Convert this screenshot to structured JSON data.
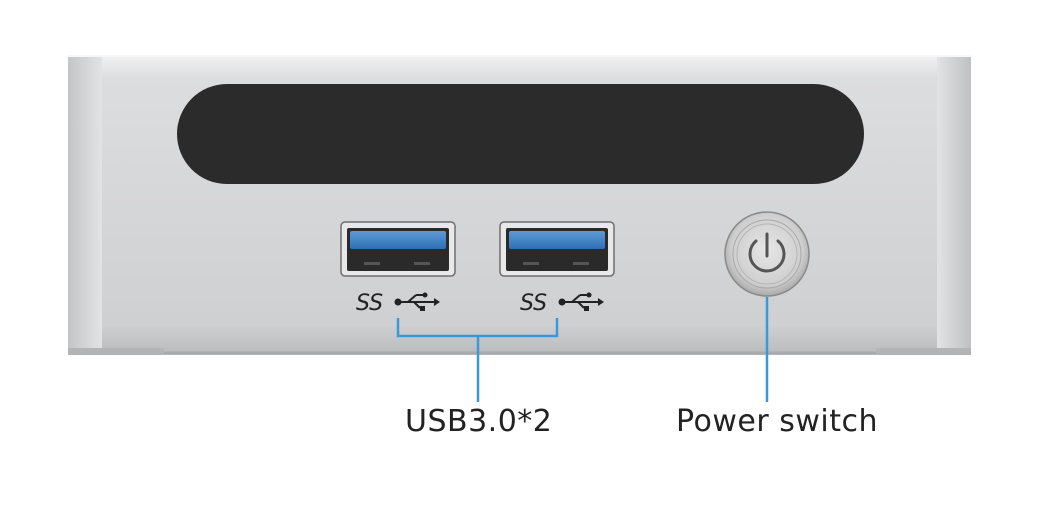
{
  "ports": [
    {
      "marking_ss": "SS",
      "usb_symbol": "usb-trident-icon"
    },
    {
      "marking_ss": "SS",
      "usb_symbol": "usb-trident-icon"
    }
  ],
  "callouts": {
    "usb_label": "USB3.0*2",
    "power_label": "Power switch"
  },
  "colors": {
    "chassis": "#d4d5d7",
    "panel": "#2b2b2b",
    "usb_insert": "#3b7fc4",
    "callout_line": "#3a9ad9",
    "label_text": "#222222"
  },
  "icons": [
    "power-icon",
    "usb-trident-icon"
  ]
}
